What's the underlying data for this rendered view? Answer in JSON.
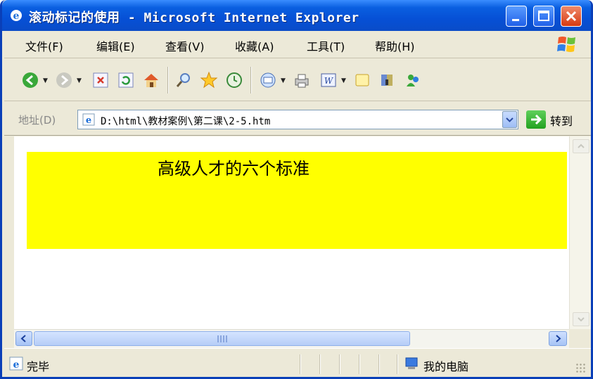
{
  "window": {
    "title": "滚动标记的使用 - Microsoft Internet Explorer",
    "icon": "ie-icon",
    "controls": [
      "minimize-icon",
      "maximize-icon",
      "close-icon"
    ]
  },
  "menu": {
    "items": [
      "文件(F)",
      "编辑(E)",
      "查看(V)",
      "收藏(A)",
      "工具(T)",
      "帮助(H)"
    ]
  },
  "toolbar": {
    "icons": [
      "back-icon",
      "forward-icon",
      "stop-icon",
      "refresh-icon",
      "home-icon",
      "search-icon",
      "favorites-icon",
      "history-icon",
      "mail-icon",
      "print-icon",
      "edit-icon",
      "discuss-icon",
      "research-icon",
      "messenger-icon"
    ]
  },
  "address": {
    "label": "地址(D)",
    "value": "D:\\html\\教材案例\\第二课\\2-5.htm",
    "go_label": "转到"
  },
  "content": {
    "marquee_text": "高级人才的六个标准",
    "marquee_bg": "#ffff00"
  },
  "status": {
    "text": "完毕",
    "zone": "我的电脑"
  },
  "colors": {
    "titlebar": "#0a5fe0",
    "chrome": "#ece9d8"
  }
}
